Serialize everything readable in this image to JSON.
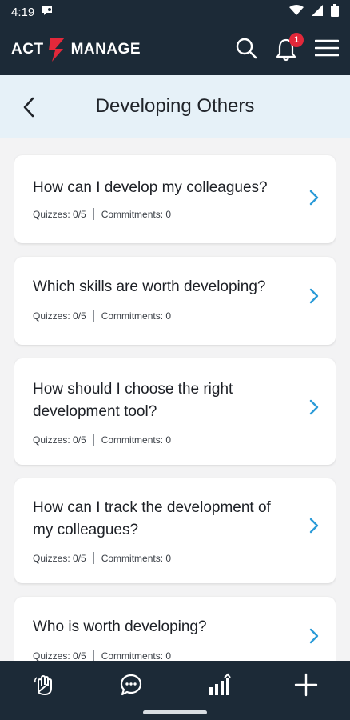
{
  "status_bar": {
    "time": "4:19"
  },
  "app_bar": {
    "logo_left": "ACT",
    "logo_right": "MANAGE",
    "notification_count": "1",
    "icons": [
      "search-icon",
      "bell-icon",
      "menu-icon"
    ]
  },
  "header": {
    "title": "Developing Others"
  },
  "topics": [
    {
      "title": "How can I develop my colleagues?",
      "quizzes": "Quizzes: 0/5",
      "commitments": "Commitments: 0"
    },
    {
      "title": "Which skills are worth developing?",
      "quizzes": "Quizzes: 0/5",
      "commitments": "Commitments: 0"
    },
    {
      "title": "How should I choose the right development tool?",
      "quizzes": "Quizzes: 0/5",
      "commitments": "Commitments: 0"
    },
    {
      "title": "How can I track the development of my colleagues?",
      "quizzes": "Quizzes: 0/5",
      "commitments": "Commitments: 0"
    },
    {
      "title": "Who is worth developing?",
      "quizzes": "Quizzes: 0/5",
      "commitments": "Commitments: 0"
    }
  ],
  "bottom_nav": [
    "hand-icon",
    "chat-icon",
    "stats-icon",
    "plus-icon"
  ],
  "colors": {
    "dark": "#1c2a37",
    "accent": "#2b9bd8",
    "brand_red": "#e2283a",
    "header_bg": "#e6f1f8"
  }
}
